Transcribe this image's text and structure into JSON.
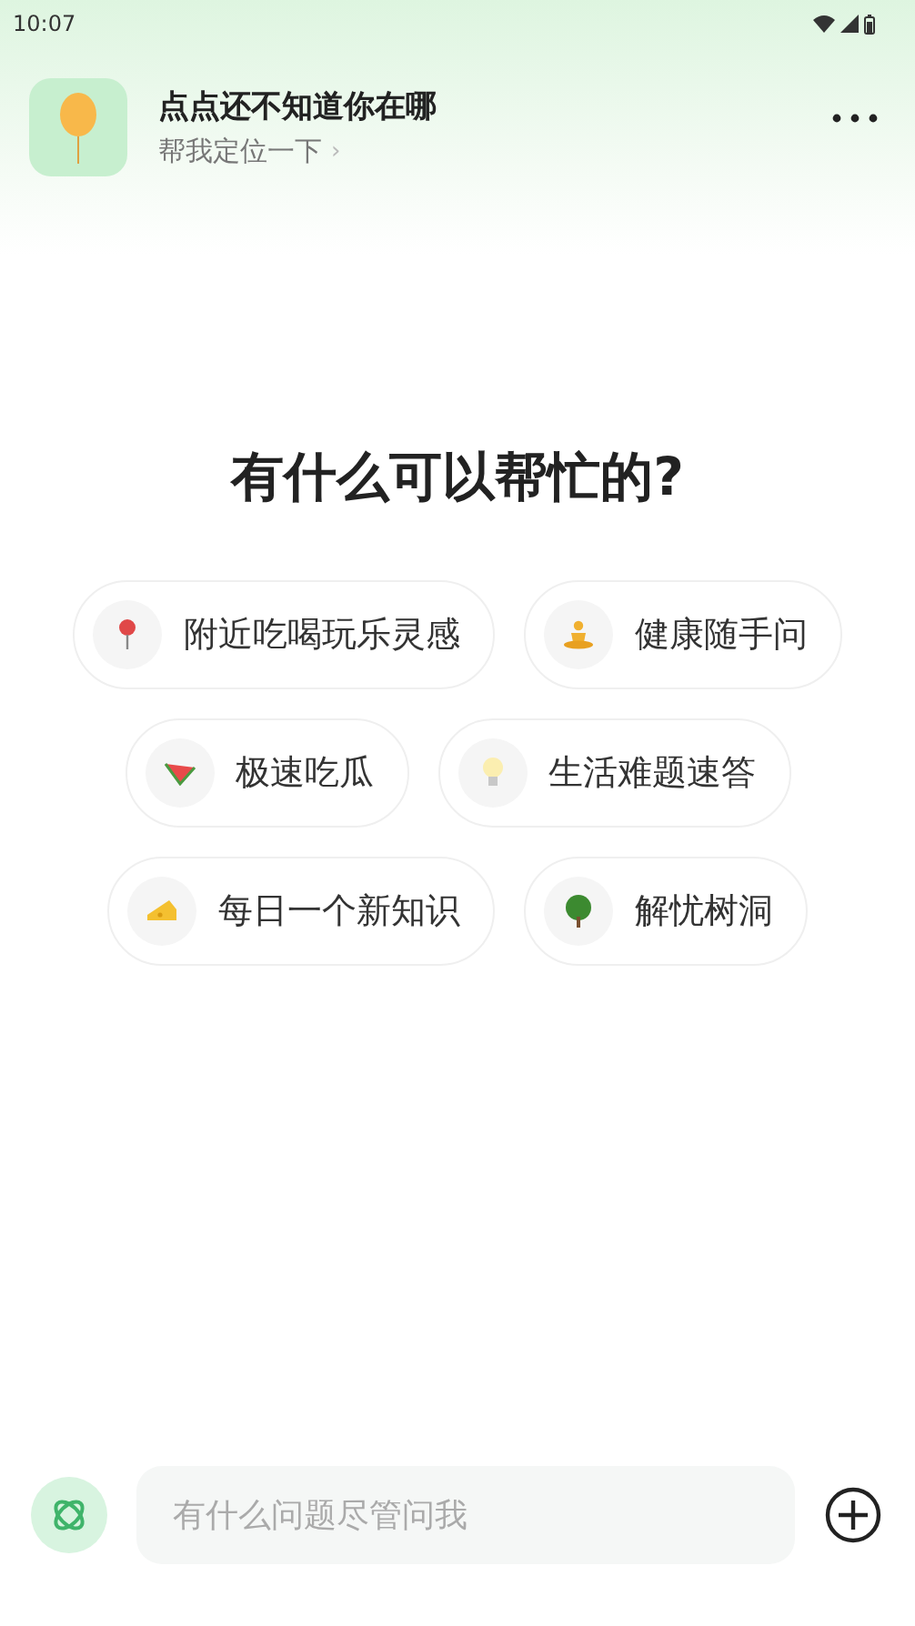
{
  "status_bar": {
    "time": "10:07"
  },
  "header": {
    "title": "点点还不知道你在哪",
    "subtitle": "帮我定位一下",
    "chevron": "›"
  },
  "heading": "有什么可以帮忙的?",
  "suggestion_rows": [
    [
      {
        "label": "附近吃喝玩乐灵感",
        "kind": "pin"
      },
      {
        "label": "健康随手问",
        "kind": "meditation"
      }
    ],
    [
      {
        "label": "极速吃瓜",
        "kind": "watermelon"
      },
      {
        "label": "生活难题速答",
        "kind": "bulb"
      }
    ],
    [
      {
        "label": "每日一个新知识",
        "kind": "cheese"
      },
      {
        "label": "解忧树洞",
        "kind": "tree"
      }
    ]
  ],
  "input": {
    "placeholder": "有什么问题尽管问我"
  }
}
